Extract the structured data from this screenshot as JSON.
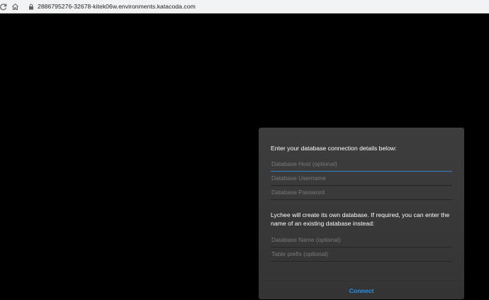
{
  "browser": {
    "url": "2886795276-32678-kitek06w.environments.katacoda.com",
    "icons": {
      "reload": "reload-icon",
      "home": "home-icon",
      "lock": "lock-icon"
    }
  },
  "login": {
    "intro": "Enter your database connection details below:",
    "fields": {
      "db_host": {
        "placeholder": "Database Host (optional)",
        "value": ""
      },
      "db_user": {
        "placeholder": "Database Username",
        "value": ""
      },
      "db_password": {
        "placeholder": "Database Password",
        "value": ""
      }
    },
    "db_note": "Lychee will create its own database. If required, you can enter the name of an existing database instead:",
    "fields2": {
      "db_name": {
        "placeholder": "Database Name (optional)",
        "value": ""
      },
      "db_prefix": {
        "placeholder": "Table prefix (optional)",
        "value": ""
      }
    },
    "connect_label": "Connect",
    "colors": {
      "accent": "#2293ec",
      "focus_line": "#3483c9",
      "modal_bg": "#3a3a3a",
      "page_bg": "#000000"
    }
  }
}
